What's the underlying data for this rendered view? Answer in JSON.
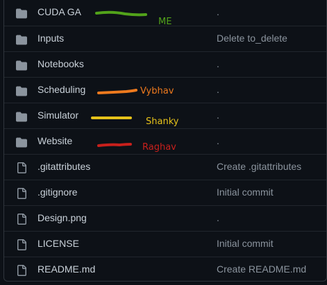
{
  "files": [
    {
      "type": "folder",
      "name": "CUDA GA",
      "message": "."
    },
    {
      "type": "folder",
      "name": "Inputs",
      "message": "Delete to_delete"
    },
    {
      "type": "folder",
      "name": "Notebooks",
      "message": "."
    },
    {
      "type": "folder",
      "name": "Scheduling",
      "message": "."
    },
    {
      "type": "folder",
      "name": "Simulator",
      "message": "."
    },
    {
      "type": "folder",
      "name": "Website",
      "message": "."
    },
    {
      "type": "file",
      "name": ".gitattributes",
      "message": "Create .gitattributes"
    },
    {
      "type": "file",
      "name": ".gitignore",
      "message": "Initial commit"
    },
    {
      "type": "file",
      "name": "Design.png",
      "message": "."
    },
    {
      "type": "file",
      "name": "LICENSE",
      "message": "Initial commit"
    },
    {
      "type": "file",
      "name": "README.md",
      "message": "Create README.md"
    }
  ],
  "annotations": [
    {
      "label": "ME",
      "color": "#52a31a"
    },
    {
      "label": "Vybhav",
      "color": "#ee7a1e"
    },
    {
      "label": "Shanky",
      "color": "#e6c21a"
    },
    {
      "label": "Raghav",
      "color": "#c8201c"
    }
  ],
  "icons": {
    "folder": "folder-icon",
    "file": "file-icon"
  },
  "colors": {
    "background": "#0d1117",
    "folder_icon": "#8b949e",
    "file_text": "#c9d1d9",
    "commit_text": "#8b949e"
  }
}
